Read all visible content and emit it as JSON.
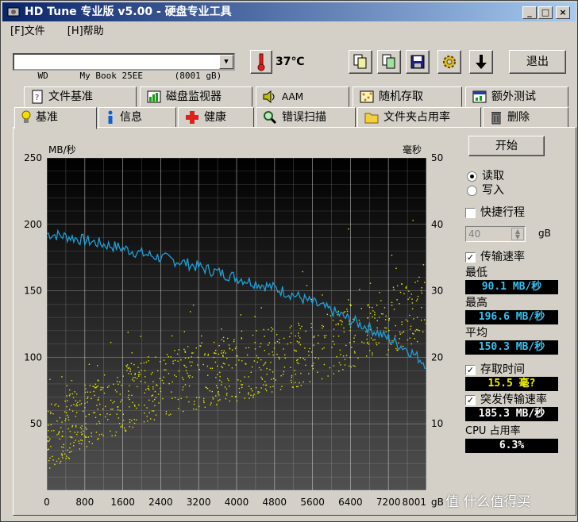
{
  "window": {
    "title": "HD Tune 专业版 v5.00 - 硬盘专业工具"
  },
  "menu": [
    {
      "label": "[F]文件"
    },
    {
      "label": "[H]帮助"
    }
  ],
  "toolbar": {
    "device": "WD      My Book 25EE      (8001 gB)",
    "temperature": "37℃",
    "exit_label": "退出"
  },
  "tabs_top": [
    {
      "label": "文件基准",
      "icon": "file-icon"
    },
    {
      "label": "磁盘监视器",
      "icon": "monitor-chart-icon"
    },
    {
      "label": "AAM",
      "icon": "speaker-icon"
    },
    {
      "label": "随机存取",
      "icon": "random-access-icon"
    },
    {
      "label": "额外测试",
      "icon": "extra-test-icon"
    }
  ],
  "tabs_bottom": [
    {
      "label": "基准",
      "icon": "lightbulb-icon"
    },
    {
      "label": "信息",
      "icon": "info-icon"
    },
    {
      "label": "健康",
      "icon": "health-cross-icon"
    },
    {
      "label": "错误扫描",
      "icon": "magnifier-icon"
    },
    {
      "label": "文件夹占用率",
      "icon": "folder-icon"
    },
    {
      "label": "删除",
      "icon": "trash-icon"
    }
  ],
  "side": {
    "start_label": "开始",
    "read_label": "读取",
    "write_label": "写入",
    "quick_label": "快捷行程",
    "quick_value": "40",
    "quick_unit": "gB",
    "transfer_label": "传输速率",
    "min_label": "最低",
    "min_value": "90.1 MB/秒",
    "max_label": "最高",
    "max_value": "196.6 MB/秒",
    "avg_label": "平均",
    "avg_value": "150.3 MB/秒",
    "access_label": "存取时间",
    "access_value": "15.5 毫?",
    "burst_label": "突发传输速率",
    "burst_value": "185.3 MB/秒",
    "cpu_label": "CPU 占用率",
    "cpu_value": "6.3%"
  },
  "watermark": "值 什么值得买",
  "chart_data": {
    "type": "line",
    "left_axis_label": "MB/秒",
    "right_axis_label": "毫秒",
    "x_unit": "gB",
    "x_ticks": [
      "0",
      "800",
      "1600",
      "2400",
      "3200",
      "4000",
      "4800",
      "5600",
      "6400",
      "7200",
      "8001"
    ],
    "y_left_ticks": [
      "250",
      "200",
      "150",
      "100",
      "50"
    ],
    "y_right_ticks": [
      "50",
      "40",
      "30",
      "20",
      "10"
    ],
    "ylim_left": [
      0,
      250
    ],
    "ylim_right": [
      0,
      50
    ],
    "xlim": [
      0,
      8001
    ],
    "series": [
      {
        "color": "#1ea0d8",
        "x": [
          0,
          400,
          800,
          1200,
          1600,
          2000,
          2400,
          2800,
          3200,
          3600,
          4000,
          4400,
          4800,
          5200,
          5600,
          6000,
          6400,
          6800,
          7200,
          7600,
          8001
        ],
        "y": [
          193,
          191,
          188,
          185,
          182,
          178,
          175,
          172,
          168,
          164,
          160,
          156,
          152,
          147,
          141,
          135,
          128,
          122,
          114,
          106,
          95
        ]
      }
    ],
    "access_points_color": "#e6e600",
    "access_time_trend_ms": {
      "x": [
        0,
        1000,
        2000,
        3000,
        4000,
        5000,
        6000,
        7000,
        8000
      ],
      "y": [
        8,
        12,
        15,
        17,
        18.5,
        20,
        22,
        25,
        28
      ]
    },
    "grid": true
  }
}
